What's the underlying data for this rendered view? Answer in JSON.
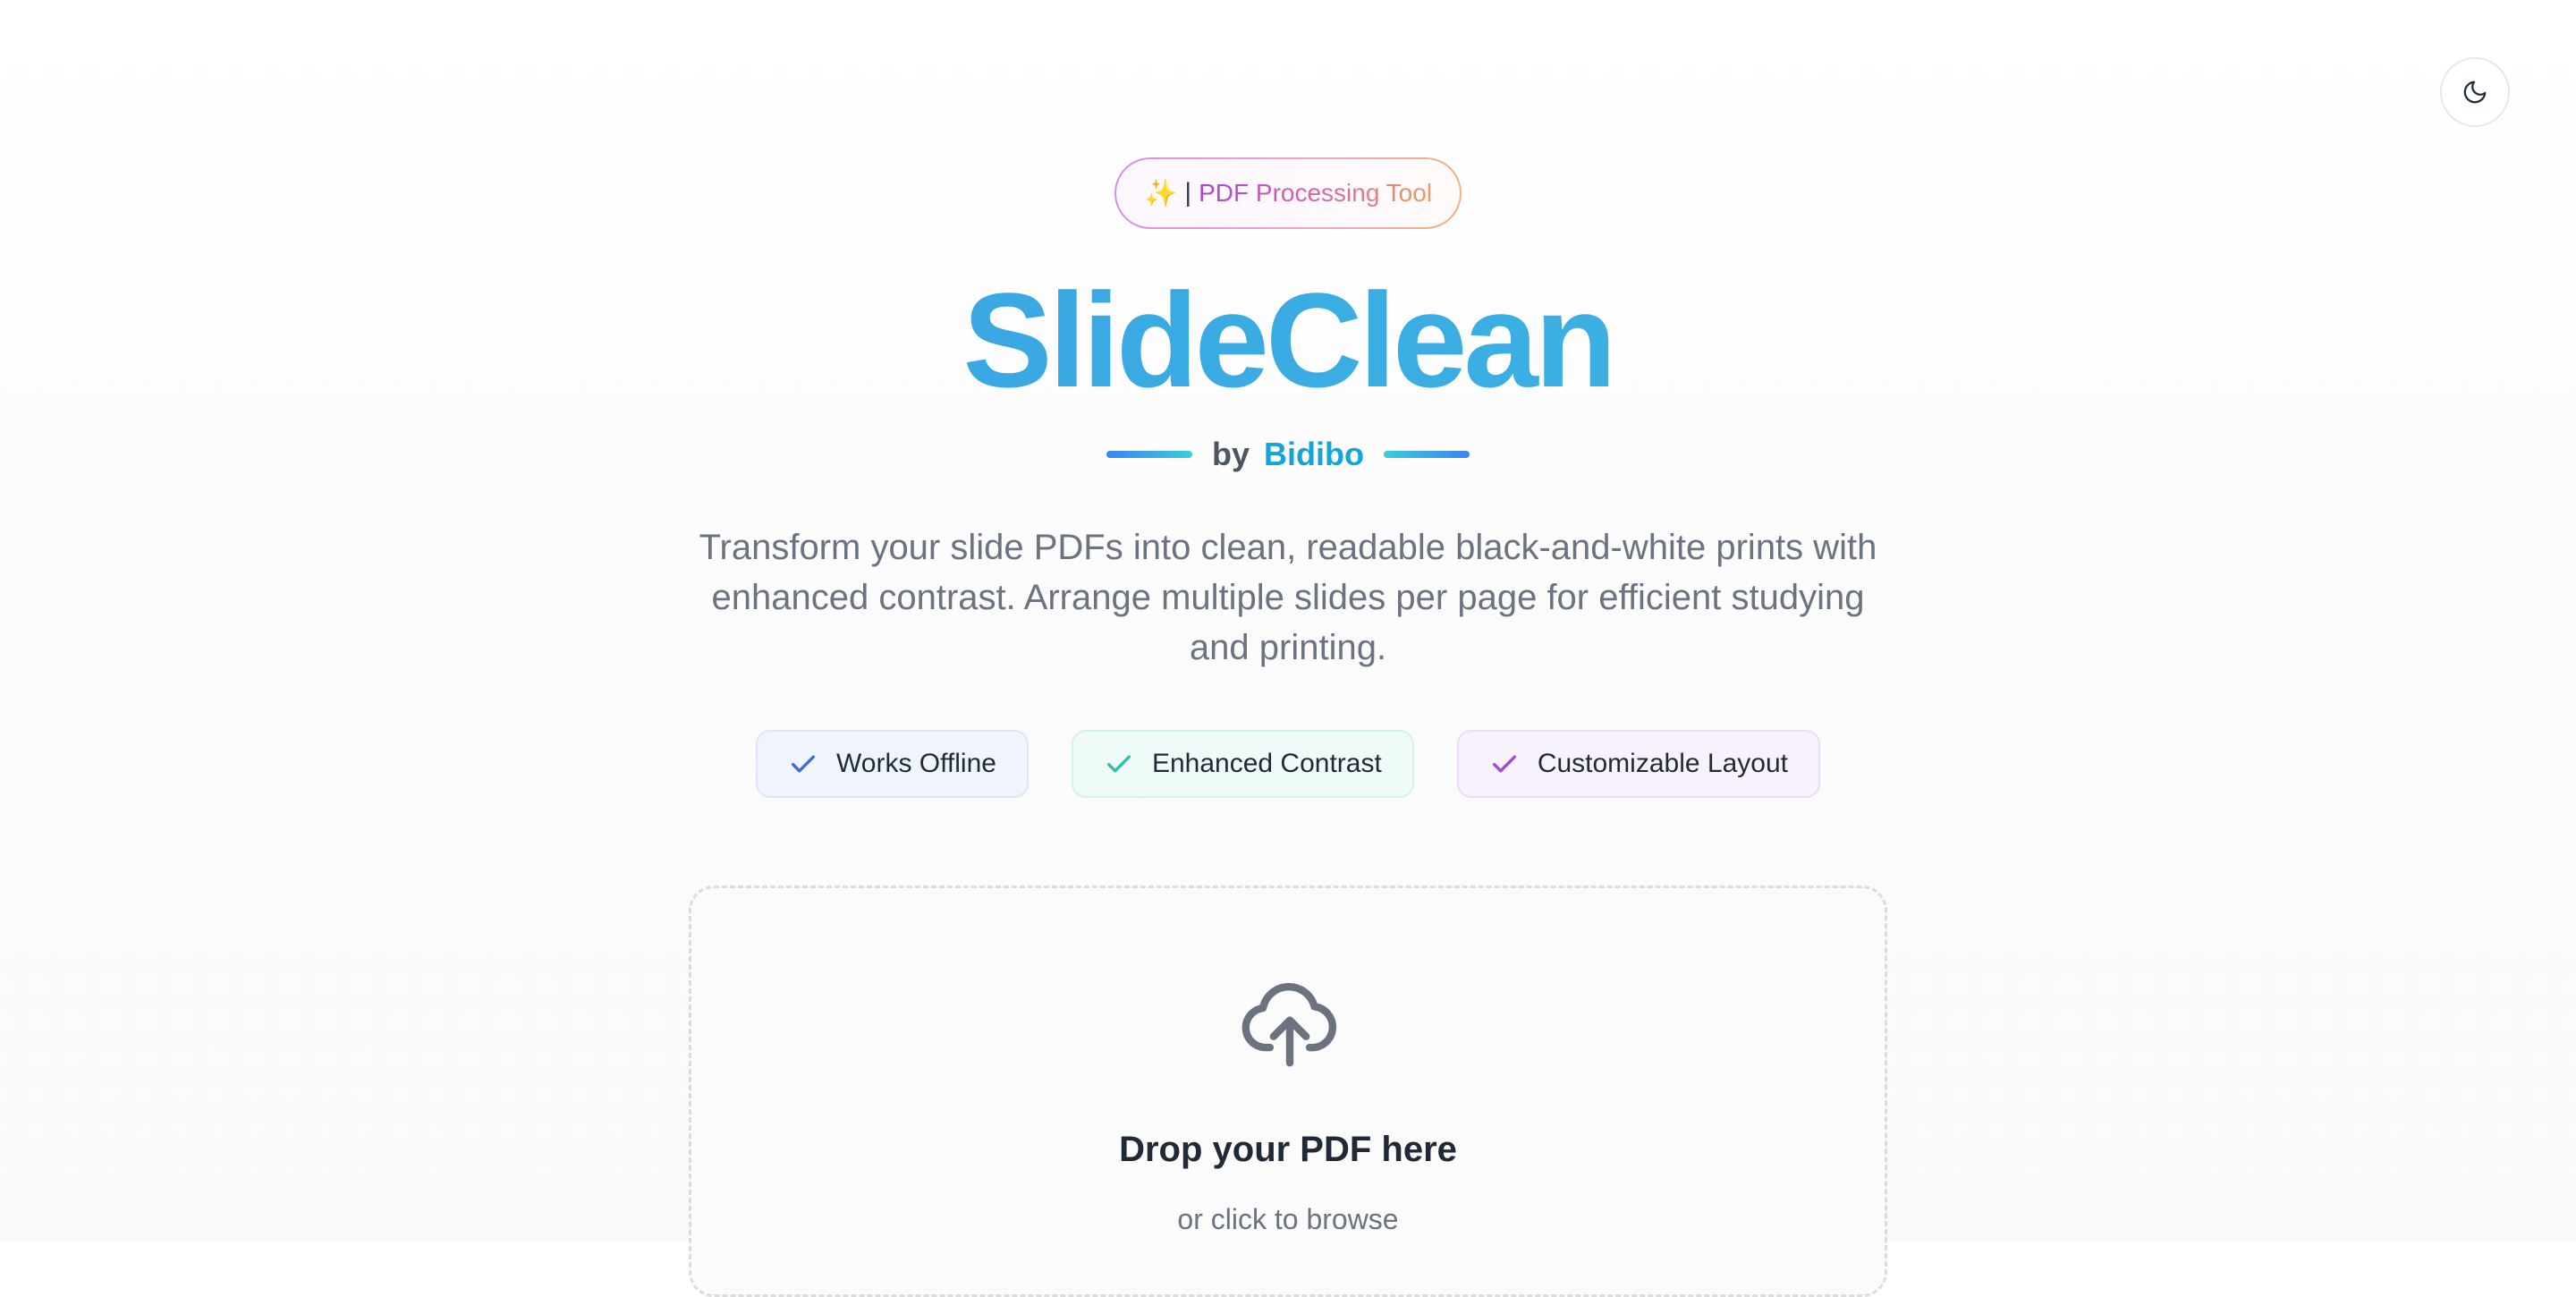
{
  "header": {
    "theme_toggle_icon": "moon-icon"
  },
  "badge": {
    "sparkle": "✨",
    "separator": "|",
    "label": "PDF Processing Tool"
  },
  "hero": {
    "title": "SlideClean",
    "by": "by",
    "brand": "Bidibo",
    "description": "Transform your slide PDFs into clean, readable black-and-white prints with enhanced contrast. Arrange multiple slides per page for efficient studying and printing."
  },
  "features": [
    {
      "label": "Works Offline",
      "icon": "check-icon",
      "color": "#3b6fd8"
    },
    {
      "label": "Enhanced Contrast",
      "icon": "check-icon",
      "color": "#2cc4b0"
    },
    {
      "label": "Customizable Layout",
      "icon": "check-icon",
      "color": "#a04ad6"
    }
  ],
  "dropzone": {
    "icon": "cloud-upload-icon",
    "title": "Drop your PDF here",
    "subtitle": "or click to browse"
  },
  "colors": {
    "title_gradient_start": "#3b9be0",
    "brand": "#14a5d8",
    "muted_text": "#6b7280"
  }
}
